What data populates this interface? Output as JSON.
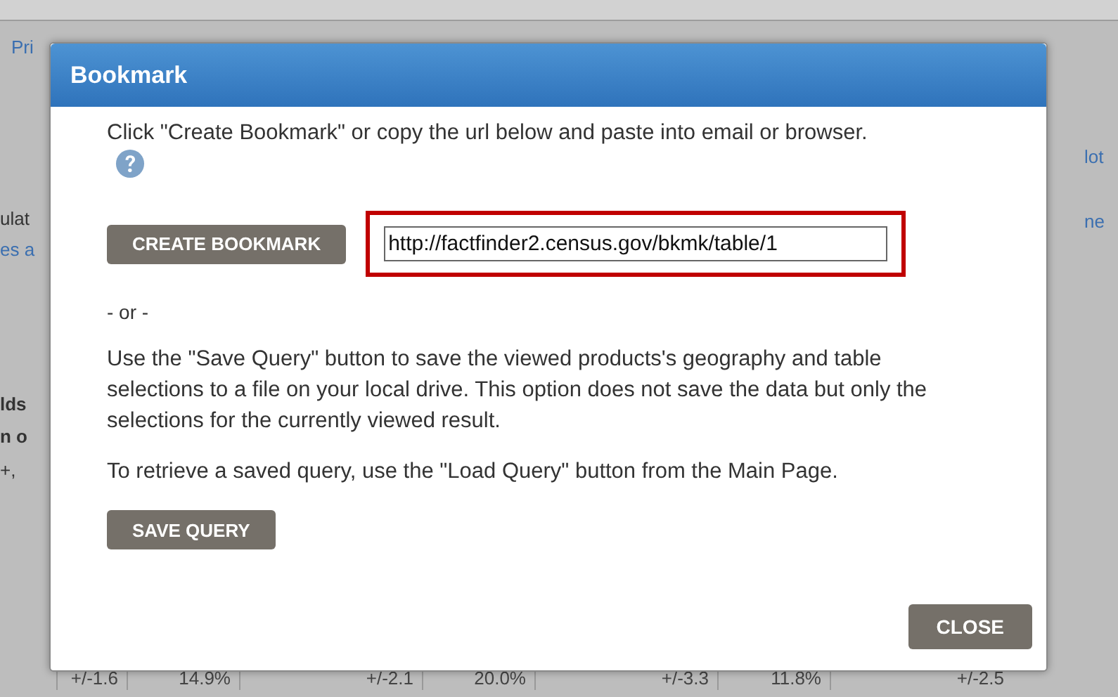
{
  "background_page": {
    "left_fragments": [
      {
        "text": "Pri",
        "kind": "link"
      },
      {
        "text": "ulat",
        "kind": "text"
      },
      {
        "text": "es a",
        "kind": "link"
      },
      {
        "text": "lds",
        "kind": "bold"
      },
      {
        "text": "n o",
        "kind": "bold"
      },
      {
        "text": "+,",
        "kind": "text"
      }
    ],
    "right_fragments": [
      {
        "text": "lot",
        "kind": "link"
      },
      {
        "text": "ne",
        "kind": "link"
      }
    ],
    "bottom_row": [
      "+/-1.6",
      "14.9%",
      "+/-2.1",
      "20.0%",
      "+/-3.3",
      "11.8%",
      "+/-2.5"
    ]
  },
  "dialog": {
    "title": "Bookmark",
    "intro": "Click \"Create Bookmark\" or copy the url below and paste into email or browser.",
    "create_button": "CREATE BOOKMARK",
    "url": "http://factfinder2.census.gov/bkmk/table/1",
    "url_highlighted": true,
    "separator": "- or -",
    "save_info": "Use the \"Save Query\" button to save the viewed products's geography and table selections to a file on your local drive. This option does not save the data but only the selections for the currently viewed result.",
    "load_info": "To retrieve a saved query, use the \"Load Query\" button from the Main Page.",
    "save_button": "SAVE QUERY",
    "close_button": "CLOSE"
  }
}
